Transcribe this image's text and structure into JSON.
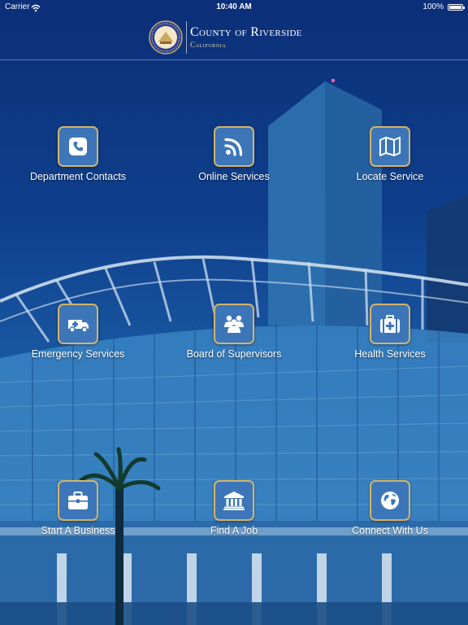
{
  "status_bar": {
    "carrier": "Carrier",
    "time": "10:40 AM",
    "battery": "100%"
  },
  "header": {
    "title": "County of Riverside",
    "subtitle": "California",
    "seal_icon": "county-seal-icon"
  },
  "colors": {
    "tile_fill": "#3d76b8",
    "tile_border": "#d4b46a",
    "background_deep": "#0b2f78"
  },
  "tiles": [
    {
      "label": "Department Contacts",
      "icon": "phone-icon"
    },
    {
      "label": "Online Services",
      "icon": "rss-icon"
    },
    {
      "label": "Locate Service",
      "icon": "map-icon"
    },
    {
      "label": "Emergency Services",
      "icon": "ambulance-icon"
    },
    {
      "label": "Board of Supervisors",
      "icon": "people-icon"
    },
    {
      "label": "Health Services",
      "icon": "medical-kit-icon"
    },
    {
      "label": "Start A Business",
      "icon": "briefcase-icon"
    },
    {
      "label": "Find A Job",
      "icon": "building-icon"
    },
    {
      "label": "Connect With Us",
      "icon": "globe-icon"
    }
  ]
}
